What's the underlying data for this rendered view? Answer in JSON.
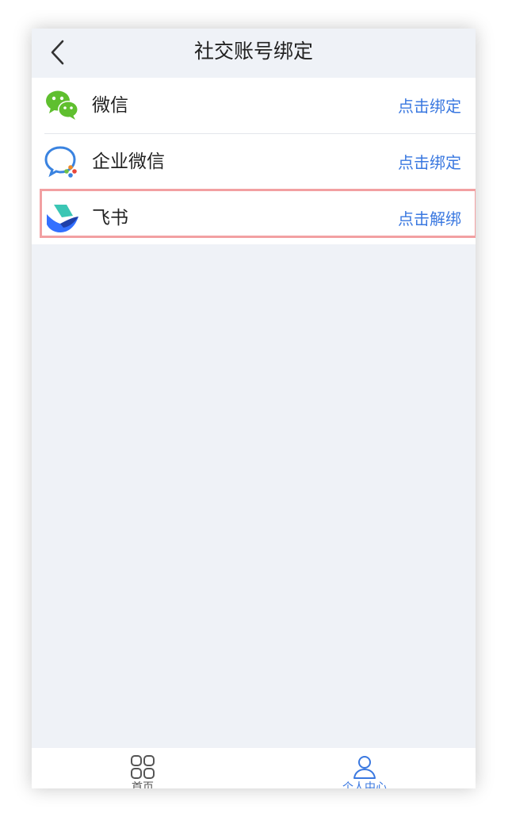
{
  "header": {
    "title": "社交账号绑定",
    "back_icon": "chevron-left-icon"
  },
  "accounts": [
    {
      "name": "微信",
      "action": "点击绑定",
      "icon": "wechat-icon"
    },
    {
      "name": "企业微信",
      "action": "点击绑定",
      "icon": "wecom-icon"
    },
    {
      "name": "飞书",
      "action": "点击解绑",
      "icon": "feishu-icon"
    }
  ],
  "tabbar": {
    "tabs": [
      {
        "label": "首页",
        "icon": "grid-icon"
      },
      {
        "label": "个人中心",
        "icon": "user-icon"
      }
    ]
  },
  "colors": {
    "accent": "#3a78e0",
    "background": "#eff2f7",
    "highlight_border": "#f2a0a2",
    "wechat_green": "#5fbf2f"
  }
}
